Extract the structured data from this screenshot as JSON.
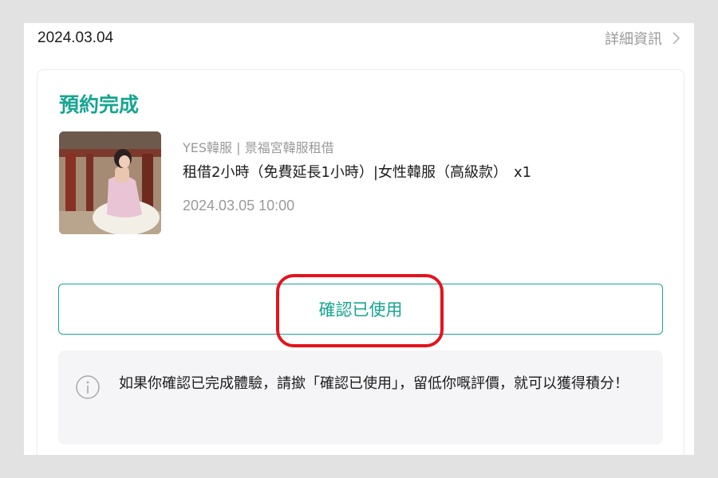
{
  "header": {
    "date": "2024.03.04",
    "detail_label": "詳細資訊"
  },
  "order": {
    "status": "預約完成",
    "vendor": "YES韓服 | 景福宮韓服租借",
    "product": "租借2小時（免費延長1小時）|女性韓服（高級款）",
    "quantity": "x1",
    "booking_time": "2024.03.05 10:00",
    "thumbnail": "woman-in-hanbok-photo"
  },
  "actions": {
    "confirm_label": "確認已使用"
  },
  "notice": {
    "icon": "info-icon",
    "text": "如果你確認已完成體驗，請撳「確認已使用」，留低你嘅評價，就可以獲得積分！"
  },
  "colors": {
    "accent": "#17a591",
    "highlight": "#e4141c",
    "muted": "#9a9a9a",
    "text": "#1c1c1c",
    "notice_bg": "#f5f5f7"
  }
}
